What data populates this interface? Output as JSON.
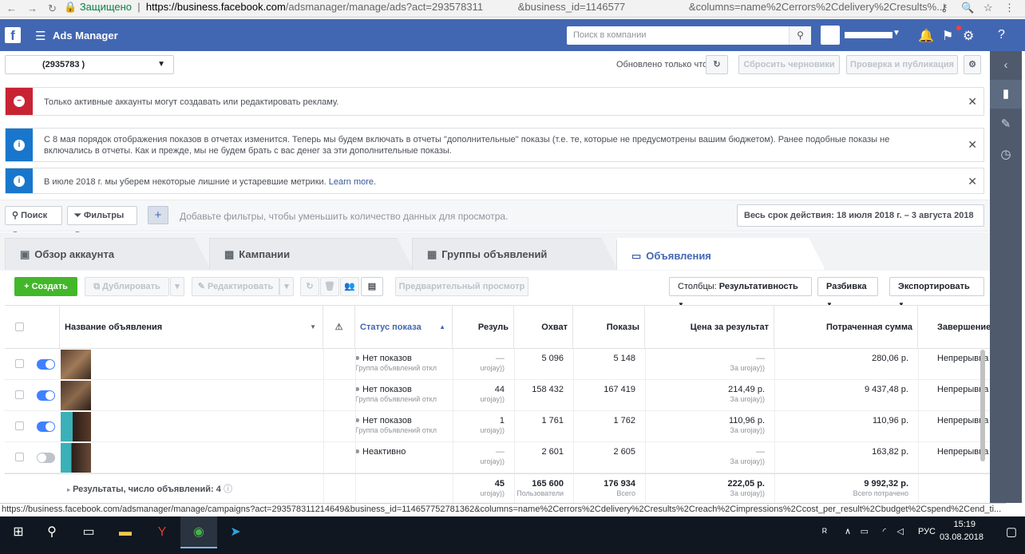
{
  "browser": {
    "secure_label": "Защищено",
    "url_host": "https://business.facebook.com",
    "url_path": "/adsmanager/manage/ads?act=293578311",
    "url_rest": "&business_id=1146577",
    "url_cols": "&columns=name%2Cerrors%2Cdelivery%2Cresults%..."
  },
  "app": {
    "title": "Ads Manager",
    "search_placeholder": "Поиск в компании"
  },
  "toolbar": {
    "account_id": "(2935783                )",
    "updated_text": "Обновлено только что",
    "reset_drafts": "Сбросить черновики",
    "review_publish": "Проверка и публикация"
  },
  "notices": [
    {
      "type": "error",
      "text": "Только активные аккаунты могут создавать или редактировать рекламу."
    },
    {
      "type": "info",
      "text": "С 8 мая порядок отображения показов в отчетах изменится. Теперь мы будем включать в отчеты \"дополнительные\" показы (т.е. те, которые не предусмотрены вашим бюджетом). Ранее подобные показы не включались в отчеты. Как и прежде, мы не будем брать с вас денег за эти дополнительные показы."
    },
    {
      "type": "info",
      "text": "В июле 2018 г. мы уберем некоторые лишние и устаревшие метрики.",
      "link": "Learn more."
    }
  ],
  "filters": {
    "search": "Поиск",
    "filters": "Фильтры",
    "hint": "Добавьте фильтры, чтобы уменьшить количество данных для просмотра.",
    "date_range": "Весь срок действия: 18 июля 2018 г. – 3 августа 2018 г."
  },
  "tabs": [
    {
      "label": "Обзор аккаунта",
      "icon": "account-icon"
    },
    {
      "label": "Кампании",
      "icon": "folder-icon"
    },
    {
      "label": "Группы объявлений",
      "icon": "grid-icon"
    },
    {
      "label": "Объявления",
      "icon": "ad-icon",
      "active": true
    }
  ],
  "actions": {
    "create": "Создать",
    "duplicate": "Дублировать",
    "edit": "Редактировать",
    "preview": "Предварительный просмотр",
    "columns_prefix": "Столбцы: ",
    "columns_value": "Результативность",
    "breakdown": "Разбивка",
    "export": "Экспортировать"
  },
  "table": {
    "headers": {
      "name": "Название объявления",
      "status": "Статус показа",
      "results": "Резуль",
      "reach": "Охват",
      "impressions": "Показы",
      "cost": "Цена за результат",
      "spent": "Потраченная сумма",
      "end": "Завершение"
    },
    "rows": [
      {
        "toggle": "on",
        "status": "Нет показов",
        "status_sub": "Группа объявлений откл",
        "results": "—",
        "results_sub": "urojay))",
        "reach": "5 096",
        "impressions": "5 148",
        "cost": "—",
        "cost_sub": "За urojay))",
        "spent": "280,06 р.",
        "end": "Непрерывна"
      },
      {
        "toggle": "on",
        "status": "Нет показов",
        "status_sub": "Группа объявлений откл",
        "results": "44",
        "results_sub": "urojay))",
        "reach": "158 432",
        "impressions": "167 419",
        "cost": "214,49 р.",
        "cost_sub": "За urojay))",
        "spent": "9 437,48 р.",
        "end": "Непрерывна"
      },
      {
        "toggle": "on",
        "status": "Нет показов",
        "status_sub": "Группа объявлений откл",
        "results": "1",
        "results_sub": "urojay))",
        "reach": "1 761",
        "impressions": "1 762",
        "cost": "110,96 р.",
        "cost_sub": "За urojay))",
        "spent": "110,96 р.",
        "end": "Непрерывна"
      },
      {
        "toggle": "off",
        "status": "Неактивно",
        "status_sub": "",
        "results": "—",
        "results_sub": "urojay))",
        "reach": "2 601",
        "impressions": "2 605",
        "cost": "—",
        "cost_sub": "За urojay))",
        "spent": "163,82 р.",
        "end": "Непрерывна"
      }
    ],
    "summary": {
      "label": "Результаты, число объявлений: 4",
      "results": "45",
      "results_sub": "urojay))",
      "reach": "165 600",
      "reach_sub": "Пользователи",
      "impressions": "176 934",
      "impressions_sub": "Всего",
      "cost": "222,05 р.",
      "cost_sub": "За urojay))",
      "spent": "9 992,32 р.",
      "spent_sub": "Всего потрачено"
    }
  },
  "statusbar": "https://business.facebook.com/adsmanager/manage/campaigns?act=293578311214649&business_id=114657752781362&columns=name%2Cerrors%2Cdelivery%2Cresults%2Creach%2Cimpressions%2Ccost_per_result%2Cbudget%2Cspend%2Cend_ti...",
  "tray": {
    "lang": "РУС",
    "time": "15:19",
    "date": "03.08.2018"
  }
}
